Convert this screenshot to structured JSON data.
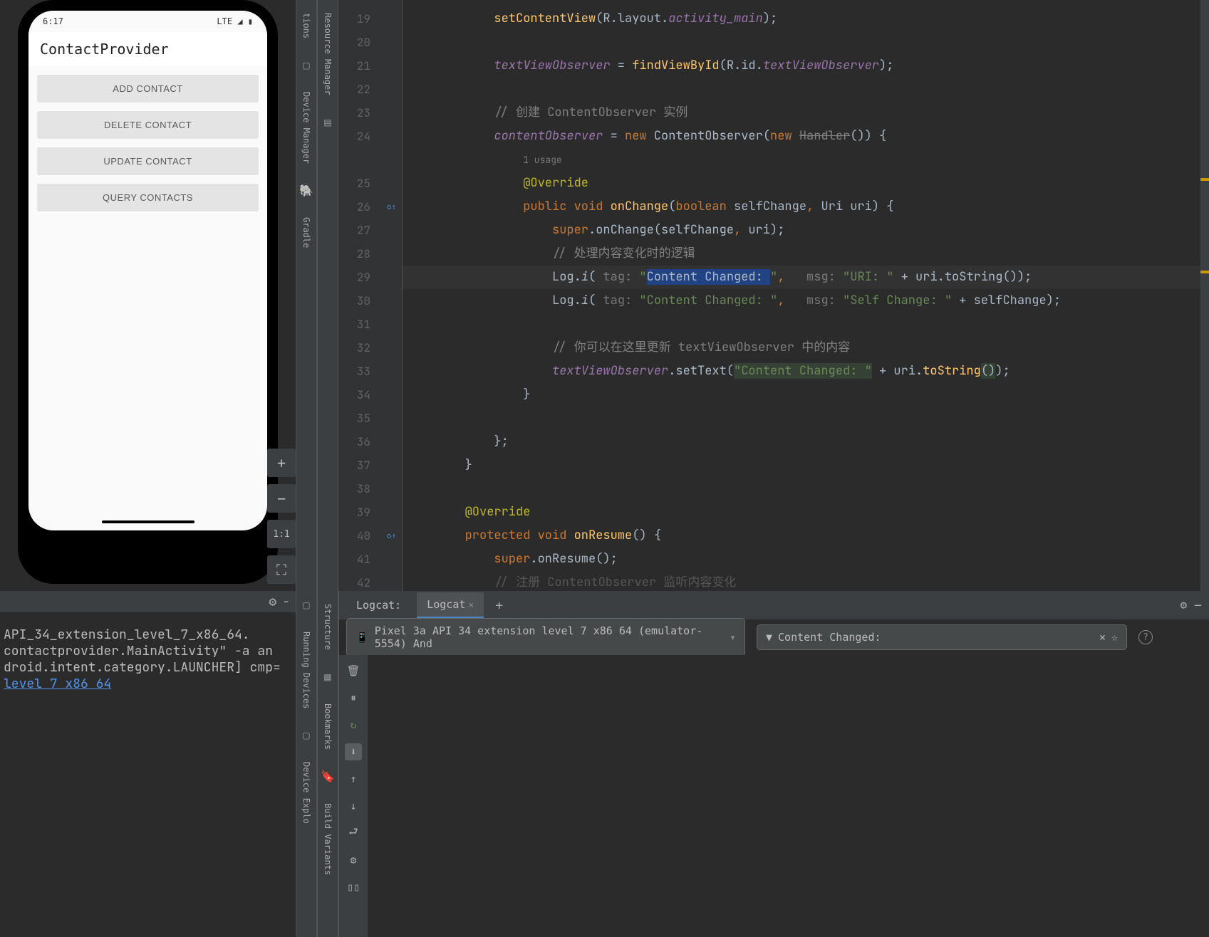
{
  "emulator": {
    "status_time": "6:17",
    "status_network": "LTE",
    "app_title": "ContactProvider",
    "buttons": [
      "ADD CONTACT",
      "DELETE CONTACT",
      "UPDATE CONTACT",
      "QUERY CONTACTS"
    ],
    "ctrl_zoom_in": "+",
    "ctrl_zoom_out": "−",
    "ctrl_fit": "1:1",
    "ctrl_expand": "⛶"
  },
  "side_rails": {
    "left1": [
      "tions",
      "Resource Manager"
    ],
    "left2": [
      "Device Manager",
      "Gradle"
    ],
    "bottom_left1": [
      "Running Devices"
    ],
    "bottom_left2": [
      "Device Explo"
    ],
    "bottom_mid": [
      "Structure",
      "Bookmarks",
      "Build Variants"
    ]
  },
  "editor": {
    "lines": [
      {
        "n": 19,
        "indent": 3,
        "tokens": [
          {
            "t": "setContentView",
            "c": "method"
          },
          {
            "t": "(R.layout.",
            "c": "type"
          },
          {
            "t": "activity_main",
            "c": "field"
          },
          {
            "t": ");",
            "c": "type"
          }
        ]
      },
      {
        "n": 20,
        "indent": 0,
        "tokens": []
      },
      {
        "n": 21,
        "indent": 3,
        "tokens": [
          {
            "t": "textViewObserver",
            "c": "field"
          },
          {
            "t": " = ",
            "c": "type"
          },
          {
            "t": "findViewById",
            "c": "method"
          },
          {
            "t": "(R.id.",
            "c": "type"
          },
          {
            "t": "textViewObserver",
            "c": "field"
          },
          {
            "t": ");",
            "c": "type"
          }
        ]
      },
      {
        "n": 22,
        "indent": 0,
        "tokens": []
      },
      {
        "n": 23,
        "indent": 3,
        "tokens": [
          {
            "t": "// 创建 ContentObserver 实例",
            "c": "comment"
          }
        ]
      },
      {
        "n": 24,
        "indent": 3,
        "tokens": [
          {
            "t": "contentObserver",
            "c": "field"
          },
          {
            "t": " = ",
            "c": "type"
          },
          {
            "t": "new ",
            "c": "kw"
          },
          {
            "t": "ContentObserver(",
            "c": "type"
          },
          {
            "t": "new ",
            "c": "kw"
          },
          {
            "t": "Handler",
            "c": "strike"
          },
          {
            "t": "()) {",
            "c": "type"
          }
        ]
      },
      {
        "n": "",
        "indent": 4,
        "tokens": [
          {
            "t": "1 usage",
            "c": "usage-count"
          }
        ],
        "usage": true
      },
      {
        "n": 25,
        "indent": 4,
        "tokens": [
          {
            "t": "@Override",
            "c": "annotation"
          }
        ]
      },
      {
        "n": 26,
        "indent": 4,
        "tokens": [
          {
            "t": "public ",
            "c": "kw"
          },
          {
            "t": "void ",
            "c": "kw"
          },
          {
            "t": "onChange",
            "c": "method"
          },
          {
            "t": "(",
            "c": "type"
          },
          {
            "t": "boolean ",
            "c": "kw"
          },
          {
            "t": "selfChange",
            "c": "param"
          },
          {
            "t": ", ",
            "c": "kw"
          },
          {
            "t": "Uri uri) {",
            "c": "type"
          }
        ],
        "override": true
      },
      {
        "n": 27,
        "indent": 5,
        "tokens": [
          {
            "t": "super",
            "c": "kw"
          },
          {
            "t": ".onChange(selfChange",
            "c": "type"
          },
          {
            "t": ", ",
            "c": "kw"
          },
          {
            "t": "uri);",
            "c": "type"
          }
        ]
      },
      {
        "n": 28,
        "indent": 5,
        "tokens": [
          {
            "t": "// 处理内容变化时的逻辑",
            "c": "comment"
          }
        ]
      },
      {
        "n": 29,
        "indent": 5,
        "hl": true,
        "tokens": [
          {
            "t": "Log.",
            "c": "type"
          },
          {
            "t": "i",
            "c": "static-method"
          },
          {
            "t": "( ",
            "c": "type"
          },
          {
            "t": "tag: ",
            "c": "tag-hint"
          },
          {
            "t": "\"",
            "c": "str"
          },
          {
            "t": "Content Changed: ",
            "c": "selected"
          },
          {
            "t": "\"",
            "c": "str"
          },
          {
            "t": ", ",
            "c": "kw"
          },
          {
            "t": "  msg: ",
            "c": "tag-hint"
          },
          {
            "t": "\"URI: \"",
            "c": "str"
          },
          {
            "t": " + uri.toString());",
            "c": "type"
          }
        ]
      },
      {
        "n": 30,
        "indent": 5,
        "tokens": [
          {
            "t": "Log.",
            "c": "type"
          },
          {
            "t": "i",
            "c": "static-method"
          },
          {
            "t": "( ",
            "c": "type"
          },
          {
            "t": "tag: ",
            "c": "tag-hint"
          },
          {
            "t": "\"Content Changed: \"",
            "c": "str"
          },
          {
            "t": ", ",
            "c": "kw"
          },
          {
            "t": "  msg: ",
            "c": "tag-hint"
          },
          {
            "t": "\"Self Change: \"",
            "c": "str"
          },
          {
            "t": " + selfChange);",
            "c": "type"
          }
        ]
      },
      {
        "n": 31,
        "indent": 0,
        "tokens": []
      },
      {
        "n": 32,
        "indent": 5,
        "tokens": [
          {
            "t": "// 你可以在这里更新 textViewObserver 中的内容",
            "c": "comment"
          }
        ]
      },
      {
        "n": 33,
        "indent": 5,
        "tokens": [
          {
            "t": "textViewObserver",
            "c": "field"
          },
          {
            "t": ".setText(",
            "c": "type"
          },
          {
            "t": "\"Content Changed: \"",
            "c": "usage-hl str"
          },
          {
            "t": " + uri.",
            "c": "type"
          },
          {
            "t": "toString",
            "c": "method"
          },
          {
            "t": "()",
            "c": "usage-hl"
          },
          {
            "t": ");",
            "c": "type"
          }
        ]
      },
      {
        "n": 34,
        "indent": 4,
        "tokens": [
          {
            "t": "}",
            "c": "type"
          }
        ]
      },
      {
        "n": 35,
        "indent": 0,
        "tokens": []
      },
      {
        "n": 36,
        "indent": 3,
        "tokens": [
          {
            "t": "};",
            "c": "type"
          }
        ]
      },
      {
        "n": 37,
        "indent": 2,
        "tokens": [
          {
            "t": "}",
            "c": "type"
          }
        ]
      },
      {
        "n": 38,
        "indent": 0,
        "tokens": []
      },
      {
        "n": 39,
        "indent": 2,
        "tokens": [
          {
            "t": "@Override",
            "c": "annotation"
          }
        ]
      },
      {
        "n": 40,
        "indent": 2,
        "tokens": [
          {
            "t": "protected ",
            "c": "kw"
          },
          {
            "t": "void ",
            "c": "kw"
          },
          {
            "t": "onResume",
            "c": "method"
          },
          {
            "t": "() {",
            "c": "type"
          }
        ],
        "override": true
      },
      {
        "n": 41,
        "indent": 3,
        "tokens": [
          {
            "t": "super",
            "c": "kw"
          },
          {
            "t": ".onResume();",
            "c": "type"
          }
        ]
      },
      {
        "n": 42,
        "indent": 3,
        "tokens": [
          {
            "t": "// 注册 ContentObserver 监听内容变化",
            "c": "comment"
          }
        ],
        "fade": true
      }
    ]
  },
  "terminal": {
    "lines": [
      "API_34_extension_level_7_x86_64.",
      "contactprovider.MainActivity\" -a an",
      "",
      "droid.intent.category.LAUNCHER] cmp=",
      "",
      ""
    ],
    "link": "level 7 x86 64"
  },
  "logcat": {
    "tabs": [
      "Logcat:",
      "Logcat"
    ],
    "device": "Pixel 3a API 34 extension level 7 x86 64 (emulator-5554) And",
    "filter": "Content Changed:"
  },
  "icons": {
    "gear": "⚙",
    "minimize": "−",
    "close": "×",
    "add": "+",
    "star": "☆",
    "help": "?",
    "filter": "▼",
    "trash": "🗑",
    "pause": "⏸",
    "restart": "↻",
    "save": "⬇",
    "up": "↑",
    "down": "↓",
    "wrap": "⮐",
    "settings2": "⚙",
    "split": "▯▯"
  }
}
